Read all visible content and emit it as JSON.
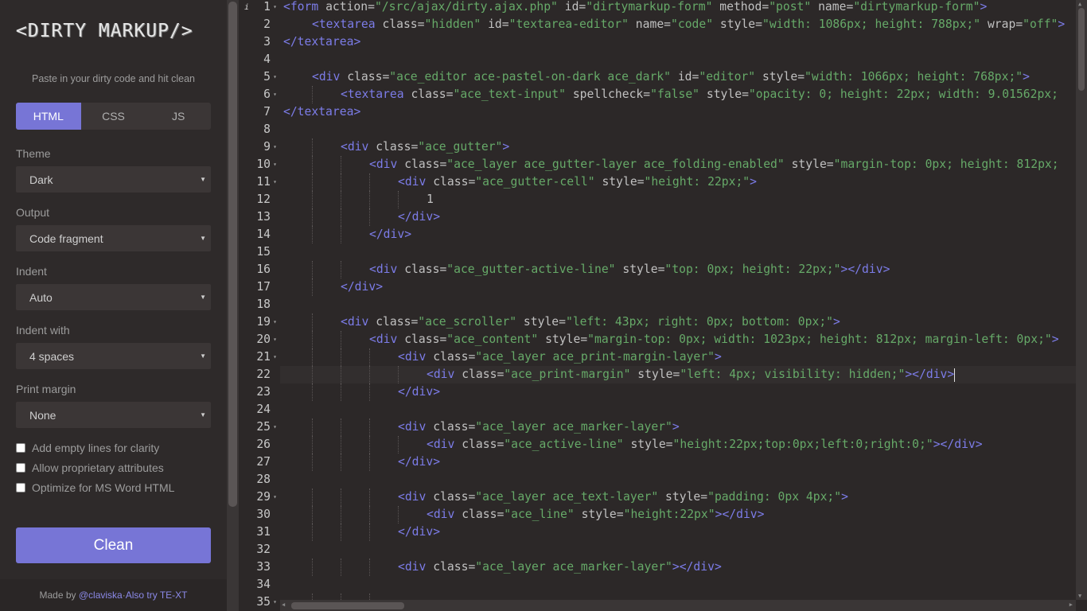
{
  "sidebar": {
    "logo_text": "<DIRTY MARKUP/>",
    "tagline": "Paste in your dirty code and hit clean",
    "tabs": [
      {
        "label": "HTML",
        "active": true
      },
      {
        "label": "CSS",
        "active": false
      },
      {
        "label": "JS",
        "active": false
      }
    ],
    "settings": [
      {
        "label": "Theme",
        "value": "Dark"
      },
      {
        "label": "Output",
        "value": "Code fragment"
      },
      {
        "label": "Indent",
        "value": "Auto"
      },
      {
        "label": "Indent with",
        "value": "4 spaces"
      },
      {
        "label": "Print margin",
        "value": "None"
      }
    ],
    "checkboxes": [
      {
        "label": "Add empty lines for clarity",
        "checked": false
      },
      {
        "label": "Allow proprietary attributes",
        "checked": false
      },
      {
        "label": "Optimize for MS Word HTML",
        "checked": false
      }
    ],
    "clean_label": "Clean",
    "footer": {
      "made_by": "Made by ",
      "author": "@claviska",
      "separator": " · ",
      "also": "Also try TE-XT"
    }
  },
  "editor": {
    "info_icon": "i",
    "active_line": 22,
    "lines": [
      {
        "n": "1",
        "fold": true,
        "indent": 0,
        "code": "<form action=\"/src/ajax/dirty.ajax.php\" id=\"dirtymarkup-form\" method=\"post\" name=\"dirtymarkup-form\">"
      },
      {
        "n": "2",
        "fold": false,
        "indent": 1,
        "code": "<textarea class=\"hidden\" id=\"textarea-editor\" name=\"code\" style=\"width: 1086px; height: 788px;\" wrap=\"off\">"
      },
      {
        "n": "3",
        "fold": false,
        "indent": 0,
        "code": "</textarea>"
      },
      {
        "n": "4",
        "fold": false,
        "indent": 0,
        "code": ""
      },
      {
        "n": "5",
        "fold": true,
        "indent": 1,
        "code": "<div class=\"ace_editor ace-pastel-on-dark ace_dark\" id=\"editor\" style=\"width: 1066px; height: 768px;\">"
      },
      {
        "n": "6",
        "fold": true,
        "indent": 2,
        "code": "<textarea class=\"ace_text-input\" spellcheck=\"false\" style=\"opacity: 0; height: 22px; width: 9.01562px;"
      },
      {
        "n": "7",
        "fold": false,
        "indent": 0,
        "code": "</textarea>"
      },
      {
        "n": "8",
        "fold": false,
        "indent": 0,
        "code": ""
      },
      {
        "n": "9",
        "fold": true,
        "indent": 2,
        "code": "<div class=\"ace_gutter\">"
      },
      {
        "n": "10",
        "fold": true,
        "indent": 3,
        "code": "<div class=\"ace_layer ace_gutter-layer ace_folding-enabled\" style=\"margin-top: 0px; height: 812px;"
      },
      {
        "n": "11",
        "fold": true,
        "indent": 4,
        "code": "<div class=\"ace_gutter-cell\" style=\"height: 22px;\">"
      },
      {
        "n": "12",
        "fold": false,
        "indent": 5,
        "code": "1"
      },
      {
        "n": "13",
        "fold": false,
        "indent": 4,
        "code": "</div>"
      },
      {
        "n": "14",
        "fold": false,
        "indent": 3,
        "code": "</div>"
      },
      {
        "n": "15",
        "fold": false,
        "indent": 0,
        "code": ""
      },
      {
        "n": "16",
        "fold": false,
        "indent": 3,
        "code": "<div class=\"ace_gutter-active-line\" style=\"top: 0px; height: 22px;\"></div>"
      },
      {
        "n": "17",
        "fold": false,
        "indent": 2,
        "code": "</div>"
      },
      {
        "n": "18",
        "fold": false,
        "indent": 0,
        "code": ""
      },
      {
        "n": "19",
        "fold": true,
        "indent": 2,
        "code": "<div class=\"ace_scroller\" style=\"left: 43px; right: 0px; bottom: 0px;\">"
      },
      {
        "n": "20",
        "fold": true,
        "indent": 3,
        "code": "<div class=\"ace_content\" style=\"margin-top: 0px; width: 1023px; height: 812px; margin-left: 0px;\">"
      },
      {
        "n": "21",
        "fold": true,
        "indent": 4,
        "code": "<div class=\"ace_layer ace_print-margin-layer\">"
      },
      {
        "n": "22",
        "fold": false,
        "indent": 5,
        "code": "<div class=\"ace_print-margin\" style=\"left: 4px; visibility: hidden;\"></div>"
      },
      {
        "n": "23",
        "fold": false,
        "indent": 4,
        "code": "</div>"
      },
      {
        "n": "24",
        "fold": false,
        "indent": 0,
        "code": ""
      },
      {
        "n": "25",
        "fold": true,
        "indent": 4,
        "code": "<div class=\"ace_layer ace_marker-layer\">"
      },
      {
        "n": "26",
        "fold": false,
        "indent": 5,
        "code": "<div class=\"ace_active-line\" style=\"height:22px;top:0px;left:0;right:0;\"></div>"
      },
      {
        "n": "27",
        "fold": false,
        "indent": 4,
        "code": "</div>"
      },
      {
        "n": "28",
        "fold": false,
        "indent": 0,
        "code": ""
      },
      {
        "n": "29",
        "fold": true,
        "indent": 4,
        "code": "<div class=\"ace_layer ace_text-layer\" style=\"padding: 0px 4px;\">"
      },
      {
        "n": "30",
        "fold": false,
        "indent": 5,
        "code": "<div class=\"ace_line\" style=\"height:22px\"></div>"
      },
      {
        "n": "31",
        "fold": false,
        "indent": 4,
        "code": "</div>"
      },
      {
        "n": "32",
        "fold": false,
        "indent": 0,
        "code": ""
      },
      {
        "n": "33",
        "fold": false,
        "indent": 4,
        "code": "<div class=\"ace_layer ace_marker-layer\"></div>"
      },
      {
        "n": "34",
        "fold": false,
        "indent": 0,
        "code": ""
      },
      {
        "n": "35",
        "fold": true,
        "indent": 4,
        "code": ""
      }
    ]
  },
  "colors": {
    "accent": "#7775d6",
    "tag": "#7c7ce8",
    "string": "#66a968",
    "text": "#c1c1c1",
    "background": "#2c2828"
  }
}
